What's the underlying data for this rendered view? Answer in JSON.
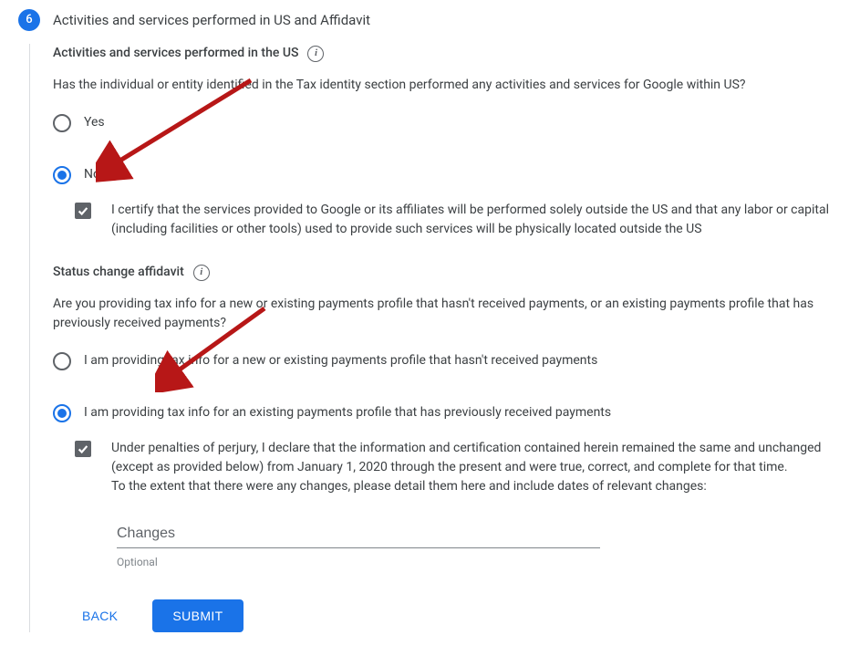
{
  "step": {
    "number": "6",
    "title": "Activities and services performed in US and Affidavit"
  },
  "sectionA": {
    "label": "Activities and services performed in the US",
    "question": "Has the individual or entity identified in the Tax identity section performed any activities and services for Google within US?",
    "options": {
      "yes": "Yes",
      "no": "No"
    },
    "certify": "I certify that the services provided to Google or its affiliates will be performed solely outside the US and that any labor or capital (including facilities or other tools) used to provide such services will be physically located outside the US"
  },
  "sectionB": {
    "label": "Status change affidavit",
    "question": "Are you providing tax info for a new or existing payments profile that hasn't received payments, or an existing payments profile that has previously received payments?",
    "options": {
      "new": "I am providing tax info for a new or existing payments profile that hasn't received payments",
      "existing": "I am providing tax info for an existing payments profile that has previously received payments"
    },
    "declare": "Under penalties of perjury, I declare that the information and certification contained herein remained the same and unchanged (except as provided below) from January 1, 2020 through the present and were true, correct, and complete for that time.\nTo the extent that there were any changes, please detail them here and include dates of relevant changes:",
    "changes_placeholder": "Changes",
    "changes_helper": "Optional"
  },
  "buttons": {
    "back": "BACK",
    "submit": "SUBMIT"
  },
  "info_glyph": "i"
}
